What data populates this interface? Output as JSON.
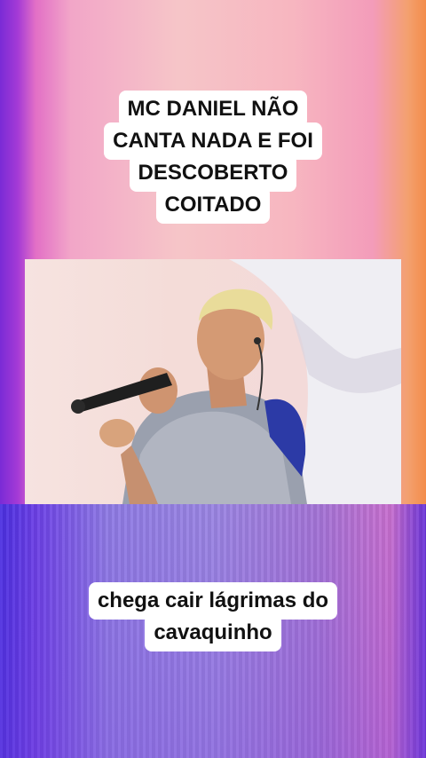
{
  "captions": {
    "top": [
      "MC DANIEL NÃO",
      "CANTA NADA E FOI",
      "DESCOBERTO",
      "COITADO"
    ],
    "bottom": [
      "chega cair lágrimas do",
      "cavaquinho"
    ]
  },
  "video": {
    "subject": "singer-with-microphone"
  },
  "colors": {
    "caption_bg": "#ffffff",
    "caption_text": "#111111",
    "bg_left": "#7a2bd6",
    "bg_right": "#f38c4a"
  }
}
